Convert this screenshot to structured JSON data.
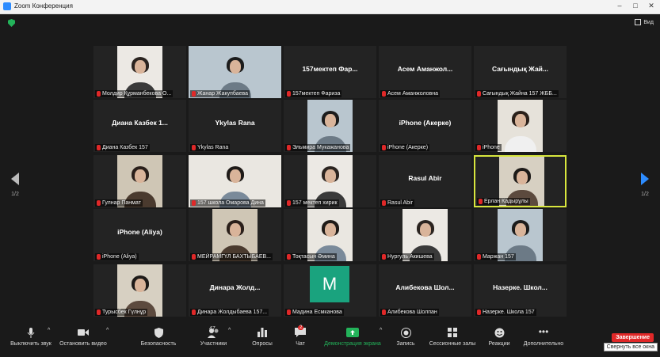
{
  "window": {
    "title": "Zoom Конференция"
  },
  "view_label": "Вид",
  "nav": {
    "left_page": "1/2",
    "right_page": "1/2"
  },
  "tiles": [
    {
      "label": "Молдир Құрманбекова О...",
      "big": "",
      "type": "video"
    },
    {
      "label": "Жанар Жакупбаева",
      "big": "",
      "type": "video"
    },
    {
      "label": "157мектеп Фариза",
      "big": "157мектеп Фар...",
      "type": "name"
    },
    {
      "label": "Асем Аманжоловна",
      "big": "Асем Аманжол...",
      "type": "name"
    },
    {
      "label": "Сағындық Жайна 157 ЖББ...",
      "big": "Сағындық Жай...",
      "type": "name"
    },
    {
      "label": "Диана Казбек 157",
      "big": "Диана Казбек 1...",
      "type": "name"
    },
    {
      "label": "Ykylas Rana",
      "big": "Ykylas Rana",
      "type": "name"
    },
    {
      "label": "Эльмира Мукажанова",
      "big": "",
      "type": "video"
    },
    {
      "label": "iPhone (Акерке)",
      "big": "iPhone (Акерке)",
      "type": "name"
    },
    {
      "label": "iPhone",
      "big": "",
      "type": "video"
    },
    {
      "label": "Гулнар Панмат",
      "big": "",
      "type": "video"
    },
    {
      "label": "157 школа Омарова Дина",
      "big": "",
      "type": "video"
    },
    {
      "label": "157 мектеп хирик",
      "big": "",
      "type": "video"
    },
    {
      "label": "Rasul Abir",
      "big": "Rasul Abir",
      "type": "name"
    },
    {
      "label": "Ерлан Кадырұлы",
      "big": "",
      "type": "video",
      "active": true
    },
    {
      "label": "iPhone (Aliya)",
      "big": "iPhone (Aliya)",
      "type": "name"
    },
    {
      "label": "МЕЙРАМГҮЛ БАХТЫБАЕВ...",
      "big": "",
      "type": "video"
    },
    {
      "label": "Тоқтасын Әмина",
      "big": "",
      "type": "video"
    },
    {
      "label": "Нургуль Акишева",
      "big": "",
      "type": "video"
    },
    {
      "label": "Маржан 157",
      "big": "",
      "type": "video"
    },
    {
      "label": "Турысбек Гүлнұр",
      "big": "",
      "type": "video"
    },
    {
      "label": "Динара Жолдыбаева 157...",
      "big": "Динара Жолд...",
      "type": "name"
    },
    {
      "label": "Мадина Есмканова",
      "big": "",
      "type": "avatar",
      "avatar_letter": "M"
    },
    {
      "label": "Алибекова Шолпан",
      "big": "Алибекова Шол...",
      "type": "name"
    },
    {
      "label": "Назерке. Школа 157",
      "big": "Назерке. Школ...",
      "type": "name"
    }
  ],
  "toolbar": {
    "mute": "Выключить звук",
    "video": "Остановить видео",
    "security": "Безопасность",
    "participants": "Участники",
    "participants_count": "47",
    "polls": "Опросы",
    "chat": "Чат",
    "chat_badge": "2",
    "share": "Демонстрация экрана",
    "record": "Запись",
    "breakout": "Сессионные залы",
    "reactions": "Реакции",
    "more": "Дополнительно",
    "end": "Завершение",
    "tooltip": "Свернуть все окна"
  },
  "colors": {
    "accent": "#2d8cff",
    "share": "#23b35a",
    "end": "#e02828",
    "active_border": "#d8e63e"
  }
}
